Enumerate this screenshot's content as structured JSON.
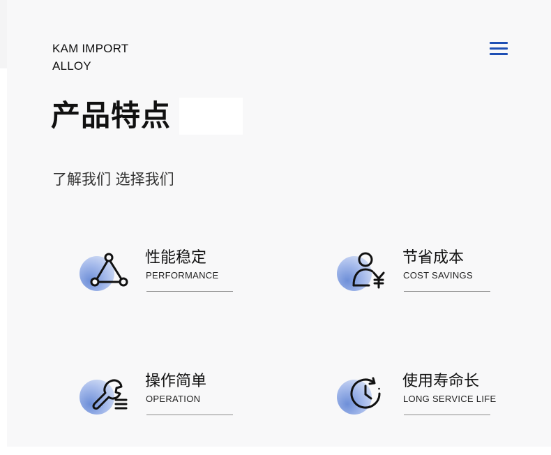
{
  "header": {
    "brand_line1": "KAM IMPORT",
    "brand_line2": "ALLOY",
    "menu_icon": "hamburger-menu-icon",
    "accent_color": "#1e4fb4"
  },
  "hero": {
    "title": "产品特点",
    "subtitle": "了解我们 选择我们"
  },
  "features": [
    {
      "title": "性能稳定",
      "subtitle": "PERFORMANCE",
      "icon": "triangle-nodes-icon"
    },
    {
      "title": "节省成本",
      "subtitle": "COST SAVINGS",
      "icon": "user-yen-icon"
    },
    {
      "title": "操作简单",
      "subtitle": "OPERATION",
      "icon": "wrench-list-icon"
    },
    {
      "title": "使用寿命长",
      "subtitle": "LONG SERVICE LIFE",
      "icon": "clock-icon"
    }
  ]
}
